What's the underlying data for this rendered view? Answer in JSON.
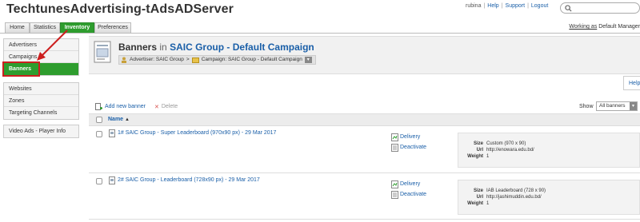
{
  "app": {
    "title": "TechtunesAdvertising-tAdsADServer"
  },
  "header": {
    "user": "rubina",
    "links": [
      "Help",
      "Support",
      "Logout"
    ]
  },
  "tabs": [
    {
      "label": "Home"
    },
    {
      "label": "Statistics"
    },
    {
      "label": "Inventory",
      "active": true
    },
    {
      "label": "Preferences"
    }
  ],
  "working_as": {
    "prefix": "Working as",
    "value": "Default Manager"
  },
  "sidebar": {
    "group1": [
      "Advertisers",
      "Campaigns",
      "Banners"
    ],
    "group2": [
      "Websites",
      "Zones",
      "Targeting Channels"
    ],
    "group3": [
      "Video Ads - Player Info"
    ],
    "active": "Banners"
  },
  "page": {
    "title_main": "Banners",
    "title_in": "in",
    "title_link": "SAIC Group - Default Campaign",
    "crumb_advertiser": "Advertiser: SAIC Group",
    "crumb_sep": ">",
    "crumb_campaign": "Campaign: SAIC Group - Default Campaign",
    "help": "Help"
  },
  "toolbar": {
    "add": "Add new banner",
    "delete": "Delete",
    "show_label": "Show",
    "show_value": "All banners"
  },
  "table": {
    "col_name": "Name",
    "sort_indicator": "▲",
    "rows": [
      {
        "name": "1# SAIC Group - Super Leaderboard (970x90 px) - 29 Mar 2017",
        "delivery": "Delivery",
        "deactivate": "Deactivate",
        "size_label": "Size",
        "size": "Custom (970 x 90)",
        "url_label": "Url",
        "url": "http://enowara.edu.bd/",
        "weight_label": "Weight",
        "weight": "1"
      },
      {
        "name": "2# SAIC Group - Leaderboard (728x90 px) - 29 Mar 2017",
        "delivery": "Delivery",
        "deactivate": "Deactivate",
        "size_label": "Size",
        "size": "IAB Leaderboard (728 x 90)",
        "url_label": "Url",
        "url": "http://jashimuddin.edu.bd/",
        "weight_label": "Weight",
        "weight": "1"
      }
    ]
  },
  "colors": {
    "accent_green": "#2e9d2e",
    "link_blue": "#1a5fa8",
    "highlight_red": "#cc1f1f"
  }
}
